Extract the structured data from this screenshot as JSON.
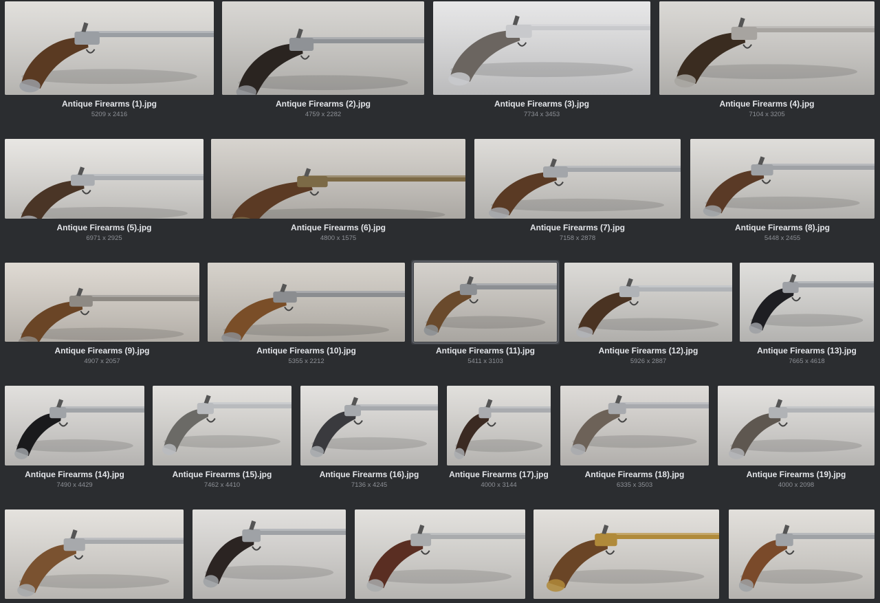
{
  "gallery": {
    "items": [
      {
        "name": "Antique Firearms (1).jpg",
        "dims": "5209 x 2416"
      },
      {
        "name": "Antique Firearms (2).jpg",
        "dims": "4759 x 2282"
      },
      {
        "name": "Antique Firearms (3).jpg",
        "dims": "7734 x 3453"
      },
      {
        "name": "Antique Firearms (4).jpg",
        "dims": "7104 x 3205"
      },
      {
        "name": "Antique Firearms (5).jpg",
        "dims": "6971 x 2925"
      },
      {
        "name": "Antique Firearms (6).jpg",
        "dims": "4800 x 1575"
      },
      {
        "name": "Antique Firearms (7).jpg",
        "dims": "7158 x 2878"
      },
      {
        "name": "Antique Firearms (8).jpg",
        "dims": "5448 x 2455"
      },
      {
        "name": "Antique Firearms (9).jpg",
        "dims": "4907 x 2057"
      },
      {
        "name": "Antique Firearms (10).jpg",
        "dims": "5355 x 2212"
      },
      {
        "name": "Antique Firearms (11).jpg",
        "dims": "5411 x 3103",
        "selected": true
      },
      {
        "name": "Antique Firearms (12).jpg",
        "dims": "5926 x 2887"
      },
      {
        "name": "Antique Firearms (13).jpg",
        "dims": "7665 x 4618"
      },
      {
        "name": "Antique Firearms (14).jpg",
        "dims": "7490 x 4429"
      },
      {
        "name": "Antique Firearms (15).jpg",
        "dims": "7462 x 4410"
      },
      {
        "name": "Antique Firearms (16).jpg",
        "dims": "7136 x 4245"
      },
      {
        "name": "Antique Firearms (17).jpg",
        "dims": "4000 x 3144"
      },
      {
        "name": "Antique Firearms (18).jpg",
        "dims": "6335 x 3503"
      },
      {
        "name": "Antique Firearms (19).jpg",
        "dims": "4000 x 2098"
      },
      {
        "name": "",
        "dims": ""
      },
      {
        "name": "",
        "dims": ""
      },
      {
        "name": "",
        "dims": ""
      },
      {
        "name": "",
        "dims": ""
      },
      {
        "name": "",
        "dims": ""
      }
    ]
  },
  "colors": {
    "background": "#2b2d30",
    "name_text": "#e4e6ea",
    "dims_text": "#8e9197"
  }
}
